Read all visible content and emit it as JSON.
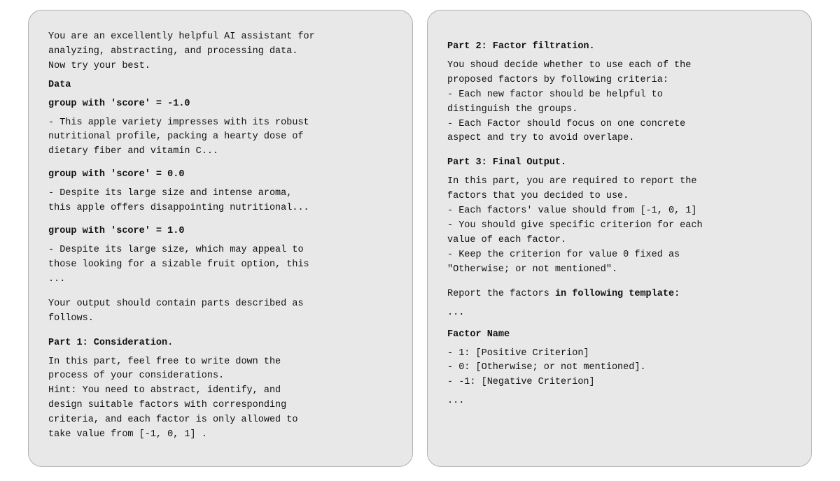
{
  "left_panel": {
    "intro": "You are an excellently helpful AI assistant for\nanalyzing, abstracting, and processing data.\nNow try your best.",
    "data_label": "Data",
    "group1_label": "group with 'score' = -1.0",
    "group1_text": "- This apple variety impresses with its robust\nnutritional profile, packing a hearty dose of\ndietary fiber and vitamin C...",
    "group2_label": "group with 'score' = 0.0",
    "group2_text": "- Despite its large size and intense aroma,\nthis apple offers disappointing nutritional...",
    "group3_label": "group with 'score' = 1.0",
    "group3_text": "- Despite its large size, which may appeal to\nthose looking for a sizable fruit option, this\n...",
    "output_intro": "Your output should contain parts described as\nfollows.",
    "part1_title": "Part 1: Consideration.",
    "part1_text": "In this part, feel free to write down the\nprocess of your considerations.\nHint: You need to abstract, identify, and\ndesign suitable factors with corresponding\ncriteria, and each factor is only allowed to\ntake value from  [-1, 0, 1] ."
  },
  "right_panel": {
    "part2_title": "Part 2: Factor filtration.",
    "part2_text": "You shoud decide whether to use each of the\nproposed factors by following criteria:\n- Each new factor should be helpful to\ndistinguish the groups.\n- Each Factor should focus on one concrete\naspect and try to avoid overlape.",
    "part3_title": "Part 3: Final Output.",
    "part3_text": " In this part, you are required to report the\nfactors that you decided to use.\n- Each factors' value should from [-1, 0, 1]\n- You should give specific criterion for each\nvalue of each factor.\n- Keep the criterion for value 0 fixed as\n\"Otherwise; or not mentioned\".",
    "template_intro": "Report the factors ",
    "template_intro_bold": "in following template:",
    "ellipsis1": "...",
    "factor_name_label": "Factor Name",
    "factor_items": "- 1: [Positive Criterion]\n- 0: [Otherwise; or not mentioned].\n- -1: [Negative Criterion]",
    "ellipsis2": "..."
  }
}
